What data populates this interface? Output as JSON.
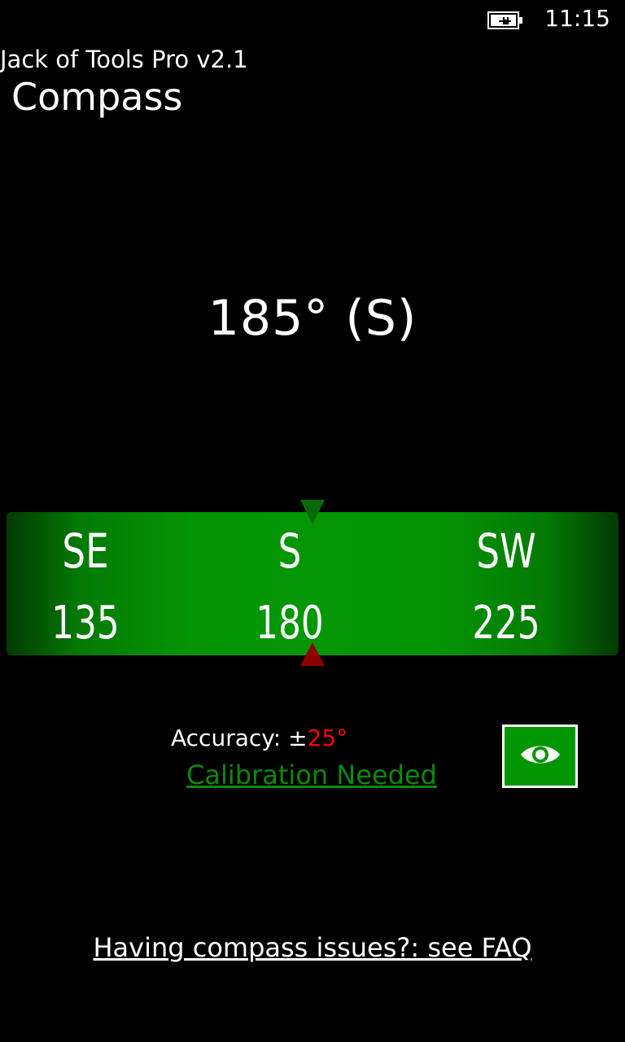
{
  "status_bar": {
    "battery_icon": "battery-charging-icon",
    "time": "11:15"
  },
  "app": {
    "name": "Jack of Tools Pro v2.1",
    "page_title": "Compass"
  },
  "compass": {
    "heading_text": "185° (S)",
    "heading_degrees": 185,
    "strip": {
      "directions": [
        "SE",
        "S",
        "SW"
      ],
      "degrees": [
        "135",
        "180",
        "225"
      ]
    },
    "top_pointer_color": "#0a6a0a",
    "bottom_pointer_color": "#8b0000"
  },
  "accuracy": {
    "label": "Accuracy: ±",
    "value": "25°",
    "value_color": "#ff0000"
  },
  "calibration_link": "Calibration Needed",
  "eye_button_icon": "eye-icon",
  "faq_link": "Having compass issues?: see FAQ",
  "colors": {
    "strip_green": "#049604",
    "link_green": "#0a8a0a",
    "button_green": "#029602"
  }
}
